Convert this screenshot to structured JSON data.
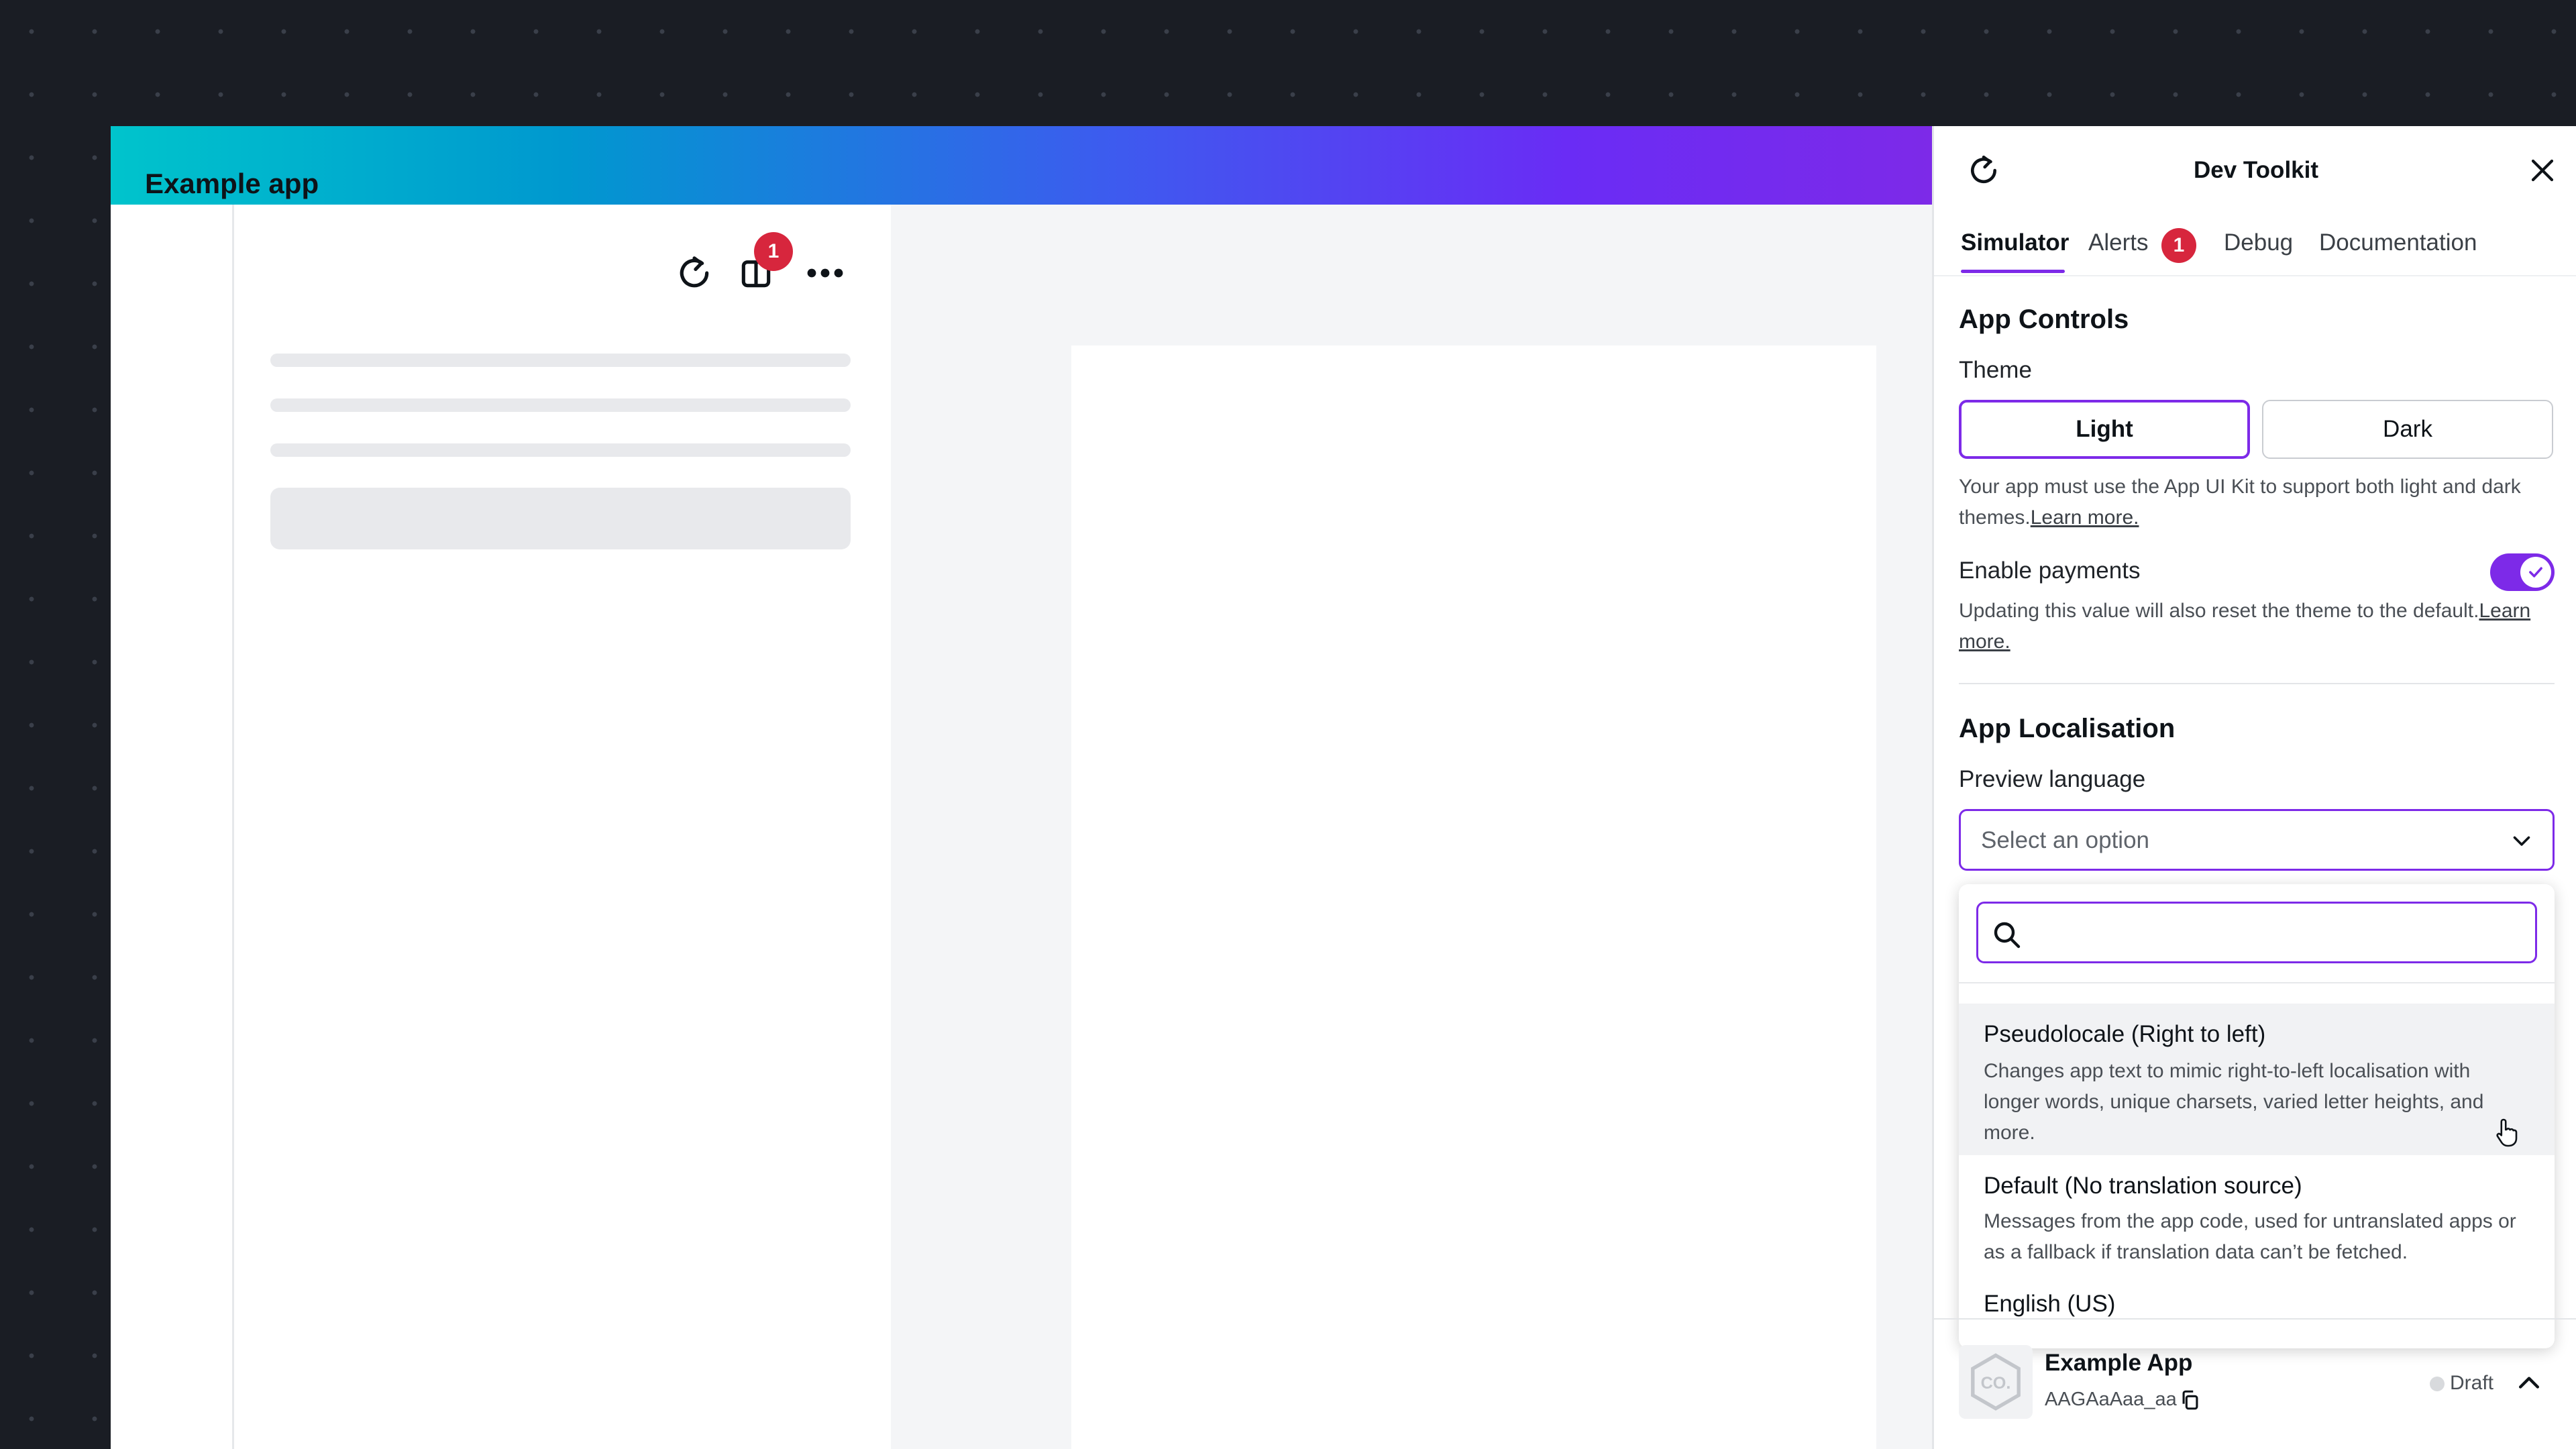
{
  "editor": {
    "app_panel": {
      "title": "Example app",
      "notification_count": "1",
      "icons": [
        "refresh-icon",
        "widget-icon",
        "more-icon"
      ]
    }
  },
  "toolkit": {
    "title": "Dev Toolkit",
    "tabs": [
      {
        "label": "Simulator",
        "active": true
      },
      {
        "label": "Alerts",
        "badge": "1"
      },
      {
        "label": "Debug"
      },
      {
        "label": "Documentation"
      }
    ],
    "app_controls": {
      "heading": "App Controls",
      "theme_label": "Theme",
      "theme_options": [
        "Light",
        "Dark"
      ],
      "theme_selected": "Light",
      "theme_help": "Your app must use the App UI Kit to support both light and dark themes.",
      "theme_help_link": "Learn more.",
      "payments_label": "Enable payments",
      "payments_enabled": true,
      "payments_help": "Updating this value will also reset the theme to the default.",
      "payments_help_link": "Learn more."
    },
    "localisation": {
      "heading": "App Localisation",
      "language_label": "Preview language",
      "select_placeholder": "Select an option",
      "search_value": "",
      "options": [
        {
          "title": "Pseudolocale (Right to left)",
          "description": "Changes app text to mimic right-to-left localisation with longer words, unique charsets, varied letter heights, and more.",
          "hovered": true
        },
        {
          "title": "Default (No translation source)",
          "description": "Messages from the app code, used for untranslated apps or as a fallback if translation data can’t be fetched."
        },
        {
          "title": "English (US)"
        }
      ]
    },
    "footer": {
      "app_name": "Example App",
      "app_id": "AAGAaAaa_aa",
      "status": "Draft",
      "logo_text": "CO."
    }
  },
  "colors": {
    "accent": "#7d2ae8",
    "badge": "#d7263d",
    "gradient_start": "#00c4cc",
    "gradient_end": "#7d2ae8"
  }
}
